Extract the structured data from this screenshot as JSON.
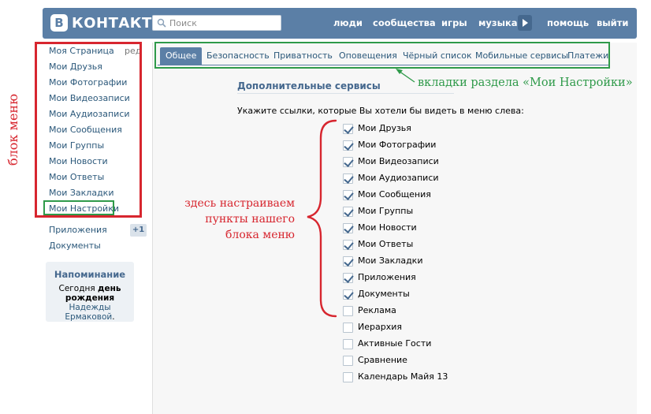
{
  "header": {
    "logo_mark": "В",
    "logo_text": "КОНТАКТЕ",
    "search_placeholder": "Поиск",
    "nav": [
      "люди",
      "сообщества",
      "игры",
      "музыка",
      "помощь",
      "выйти"
    ]
  },
  "sidebar": {
    "items": [
      "Моя Страница",
      "Мои Друзья",
      "Мои Фотографии",
      "Мои Видеозаписи",
      "Мои Аудиозаписи",
      "Мои Сообщения",
      "Мои Группы",
      "Мои Новости",
      "Мои Ответы",
      "Мои Закладки",
      "Мои Настройки"
    ],
    "edit_link": "ред.",
    "extra_items": [
      "Приложения",
      "Документы"
    ],
    "apps_badge": "+1",
    "reminder": {
      "title": "Напоминание",
      "text_1": "Сегодня",
      "text_2": "день рождения",
      "link": "Надежды Ермаковой",
      "text_end": "."
    }
  },
  "tabs": [
    "Общее",
    "Безопасность",
    "Приватность",
    "Оповещения",
    "Чёрный список",
    "Мобильные сервисы",
    "Платежи"
  ],
  "active_tab": "Общее",
  "section": {
    "title": "Дополнительные сервисы",
    "prompt": "Укажите ссылки, которые Вы хотели бы видеть в меню слева:",
    "options": [
      {
        "label": "Мои Друзья",
        "checked": true
      },
      {
        "label": "Мои Фотографии",
        "checked": true
      },
      {
        "label": "Мои Видеозаписи",
        "checked": true
      },
      {
        "label": "Мои Аудиозаписи",
        "checked": true
      },
      {
        "label": "Мои Сообщения",
        "checked": true
      },
      {
        "label": "Мои Группы",
        "checked": true
      },
      {
        "label": "Мои Новости",
        "checked": true
      },
      {
        "label": "Мои Ответы",
        "checked": true
      },
      {
        "label": "Мои Закладки",
        "checked": true
      },
      {
        "label": "Приложения",
        "checked": true
      },
      {
        "label": "Документы",
        "checked": true
      },
      {
        "label": "Реклама",
        "checked": false
      },
      {
        "label": "Иерархия",
        "checked": false
      },
      {
        "label": "Активные Гости",
        "checked": false
      },
      {
        "label": "Сравнение",
        "checked": false
      },
      {
        "label": "Календарь Майя 13",
        "checked": false
      }
    ]
  },
  "annotations": {
    "menu_block": "блок меню",
    "tabs_note": "вкладки раздела «Мои Настройки»",
    "items_note_1": "здесь настраиваем",
    "items_note_2": "пункты нашего",
    "items_note_3": "блока меню"
  },
  "colors": {
    "brand": "#5b7fa6",
    "link": "#2b587a",
    "annotation_red": "#d7262f",
    "annotation_green": "#2f9a4a"
  }
}
